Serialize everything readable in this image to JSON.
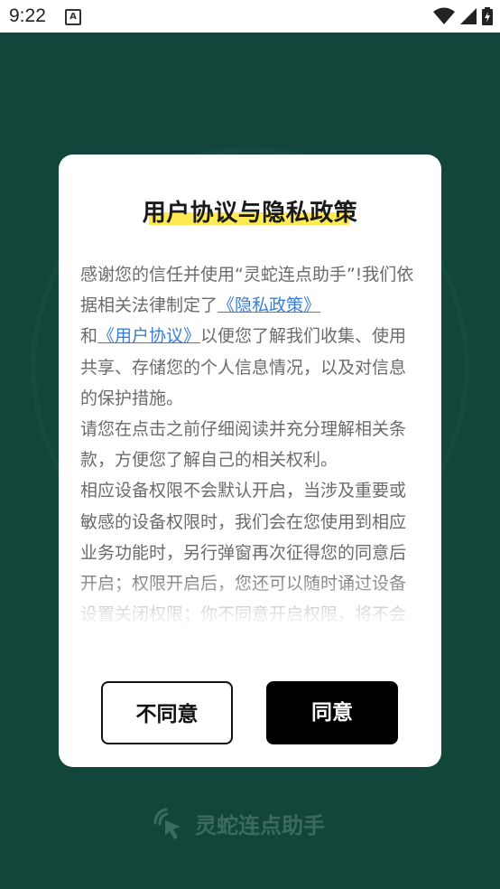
{
  "status_bar": {
    "time": "9:22",
    "notification_icon": "a-icon",
    "icons": [
      "wifi-icon",
      "signal-icon",
      "battery-icon"
    ]
  },
  "dialog": {
    "title": "用户协议与隐私政策",
    "paragraph1_start": "感谢您的信任并使用“灵蛇连点助手”!我们依据相关法律制定了",
    "privacy_link": "《隐私政策》",
    "and_text": "和",
    "agreement_link": "《用户协议》",
    "paragraph1_end": "以便您了解我们收集、使用共享、存储您的个人信息情况，以及对信息的保护措施。",
    "paragraph2": "请您在点击之前仔细阅读并充分理解相关条款，方便您了解自己的相关权利。",
    "paragraph3": "相应设备权限不会默认开启，当涉及重要或敏感的设备权限时，我们会在您使用到相应业务功能时，另行弹窗再次征得您的同意后开启；权限开启后，您还可以随时诵过设备设置关闭权限；你不同意开启权限，将不会影响其他非相关业务功能的正常使用。针对个人敏感信"
  },
  "buttons": {
    "disagree_label": "不同意",
    "agree_label": "同意"
  },
  "brand": {
    "name": "灵蛇连点助手",
    "icon": "tap-cursor-icon"
  },
  "colors": {
    "background": "#13463a",
    "link": "#3a7fd6",
    "highlight": "#ffe94a",
    "agree_button": "#000000",
    "brand_text": "#3b6a5f"
  }
}
